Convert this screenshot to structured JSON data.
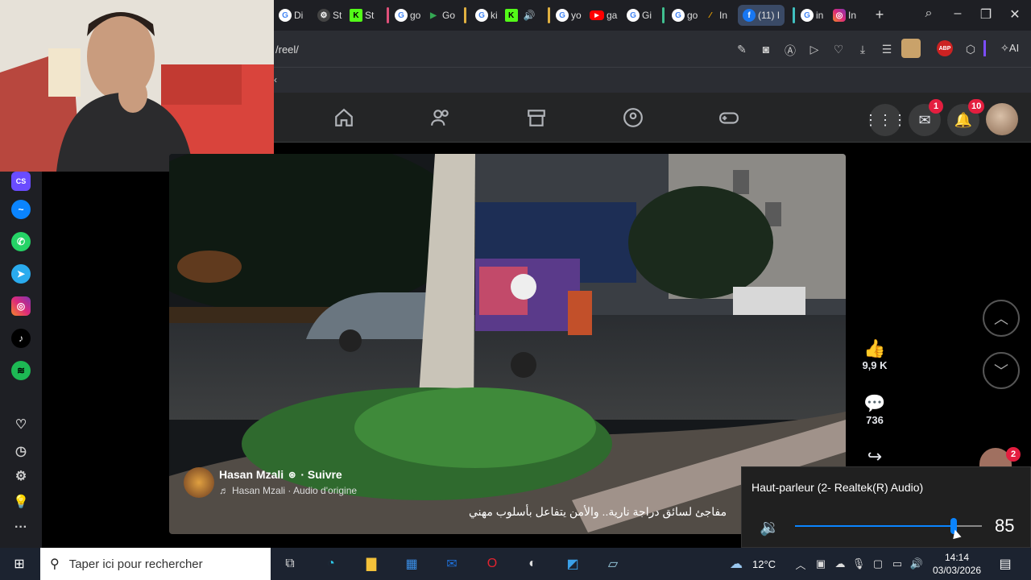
{
  "browser": {
    "tabs": [
      {
        "label": "Di",
        "icon": "google-icon"
      },
      {
        "label": "St",
        "icon": "steam-icon"
      },
      {
        "label": "St",
        "icon": "kick-icon"
      },
      {
        "label": "go",
        "icon": "google-icon"
      },
      {
        "label": "Go",
        "icon": "play-store-icon"
      },
      {
        "label": "ki",
        "icon": "google-icon"
      },
      {
        "label": "yo",
        "icon": "google-icon"
      },
      {
        "label": "ga",
        "icon": "youtube-icon"
      },
      {
        "label": "Gi",
        "icon": "google-icon"
      },
      {
        "label": "go",
        "icon": "google-icon"
      },
      {
        "label": "In",
        "icon": "analytics-icon"
      },
      {
        "label": "(11) I",
        "icon": "facebook-icon"
      },
      {
        "label": "in",
        "icon": "google-icon"
      },
      {
        "label": "In",
        "icon": "instagram-icon"
      }
    ],
    "url": "/reel/",
    "ai_label": "AI",
    "abp_label": "ABP"
  },
  "facebook": {
    "messenger_badge": "1",
    "notifications_badge": "10",
    "reel": {
      "author": "Hasan Mzali",
      "follow": "· Suivre",
      "audio": "Hasan Mzali · Audio d'origine",
      "caption": "مفاجئ لسائق دراجة نارية.. والأمن يتفاعل بأسلوب مهني",
      "likes": "9,9 K",
      "comments": "736",
      "contacts_badge": "2"
    }
  },
  "volume_flyout": {
    "device": "Haut-parleur (2- Realtek(R) Audio)",
    "level": 85
  },
  "taskbar": {
    "search_placeholder": "Taper ici pour rechercher",
    "weather": "12°C",
    "time": "14:14",
    "date": "03/03/2026"
  },
  "colors": {
    "accent": "#0a84ff",
    "fb_badge": "#e41e3f"
  }
}
